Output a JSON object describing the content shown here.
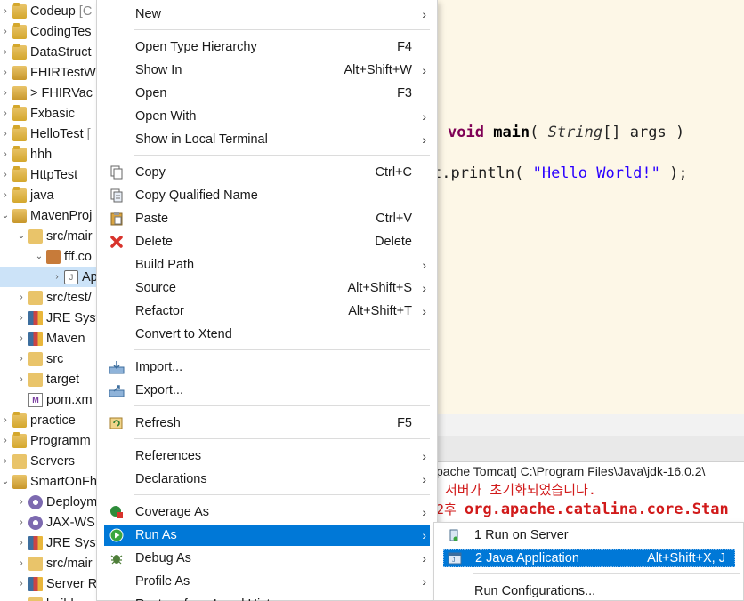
{
  "explorer": {
    "items": [
      {
        "label": "Codeup",
        "suffix": "[C",
        "icon": "project-icon",
        "chev": "›",
        "indent": 0
      },
      {
        "label": "CodingTes",
        "suffix": "",
        "icon": "project-icon",
        "chev": "›",
        "indent": 0
      },
      {
        "label": "DataStruct",
        "suffix": "",
        "icon": "project-icon",
        "chev": "›",
        "indent": 0
      },
      {
        "label": "FHIRTestW",
        "suffix": "",
        "icon": "maven-project-icon",
        "chev": "›",
        "indent": 0
      },
      {
        "label": "> FHIRVac",
        "suffix": "",
        "icon": "maven-project-icon",
        "chev": "›",
        "indent": 0
      },
      {
        "label": "Fxbasic",
        "suffix": "",
        "icon": "project-icon",
        "chev": "›",
        "indent": 0
      },
      {
        "label": "HelloTest",
        "suffix": "[",
        "icon": "project-icon",
        "chev": "›",
        "indent": 0
      },
      {
        "label": "hhh",
        "suffix": "",
        "icon": "project-icon",
        "chev": "›",
        "indent": 0
      },
      {
        "label": "HttpTest",
        "suffix": "",
        "icon": "project-icon",
        "chev": "›",
        "indent": 0
      },
      {
        "label": "java",
        "suffix": "",
        "icon": "project-icon",
        "chev": "›",
        "indent": 0
      },
      {
        "label": "MavenProj",
        "suffix": "",
        "icon": "maven-project-icon",
        "chev": "⌄",
        "indent": 0
      },
      {
        "label": "src/mair",
        "suffix": "",
        "icon": "source-folder-icon",
        "chev": "⌄",
        "indent": 1
      },
      {
        "label": "fff.co",
        "suffix": "",
        "icon": "package-icon",
        "chev": "⌄",
        "indent": 2
      },
      {
        "label": "Ap",
        "suffix": "",
        "icon": "java-file-icon",
        "chev": "›",
        "indent": 3
      },
      {
        "label": "src/test/",
        "suffix": "",
        "icon": "source-folder-icon",
        "chev": "›",
        "indent": 1
      },
      {
        "label": "JRE Syst",
        "suffix": "",
        "icon": "library-icon",
        "chev": "›",
        "indent": 1
      },
      {
        "label": "Maven",
        "suffix": "",
        "icon": "library-icon",
        "chev": "›",
        "indent": 1
      },
      {
        "label": "src",
        "suffix": "",
        "icon": "folder-icon",
        "chev": "›",
        "indent": 1
      },
      {
        "label": "target",
        "suffix": "",
        "icon": "folder-icon",
        "chev": "›",
        "indent": 1
      },
      {
        "label": "pom.xm",
        "suffix": "",
        "icon": "pom-file-icon",
        "chev": "",
        "indent": 1
      },
      {
        "label": "practice",
        "suffix": "",
        "icon": "project-icon",
        "chev": "›",
        "indent": 0
      },
      {
        "label": "Programm",
        "suffix": "",
        "icon": "project-icon",
        "chev": "›",
        "indent": 0
      },
      {
        "label": "Servers",
        "suffix": "",
        "icon": "folder-icon",
        "chev": "›",
        "indent": 0
      },
      {
        "label": "SmartOnFh",
        "suffix": "",
        "icon": "maven-project-icon",
        "chev": "⌄",
        "indent": 0
      },
      {
        "label": "Deploym",
        "suffix": "",
        "icon": "deployment-icon",
        "chev": "›",
        "indent": 1
      },
      {
        "label": "JAX-WS",
        "suffix": "",
        "icon": "webservice-icon",
        "chev": "›",
        "indent": 1
      },
      {
        "label": "JRE Syst",
        "suffix": "",
        "icon": "library-icon",
        "chev": "›",
        "indent": 1
      },
      {
        "label": "src/mair",
        "suffix": "",
        "icon": "source-folder-icon",
        "chev": "›",
        "indent": 1
      },
      {
        "label": "Server R",
        "suffix": "",
        "icon": "library-icon",
        "chev": "›",
        "indent": 1
      },
      {
        "label": "build",
        "suffix": "",
        "icon": "folder-icon",
        "chev": "›",
        "indent": 1
      }
    ]
  },
  "editor": {
    "line1": {
      "kw": "void",
      "method": "main",
      "open": "( ",
      "type": "String",
      "rest": "[] args )"
    },
    "line2": {
      "prefix": "t.println( ",
      "str": "\"Hello World!\"",
      "suffix": " );"
    }
  },
  "console": {
    "path": "pache Tomcat] C:\\Program Files\\Java\\jdk-16.0.2\\",
    "line1": "서버가 초기화되었습니다.",
    "line2_prefix": "2후 ",
    "line2_bold": "org.apache.catalina.core.Stan"
  },
  "context_menu": {
    "items": [
      {
        "label": "New",
        "shortcut": "",
        "arrow": "›",
        "icon": ""
      },
      {
        "label": "Open Type Hierarchy",
        "shortcut": "F4",
        "arrow": "",
        "icon": ""
      },
      {
        "label": "Show In",
        "shortcut": "Alt+Shift+W",
        "arrow": "›",
        "icon": ""
      },
      {
        "label": "Open",
        "shortcut": "F3",
        "arrow": "",
        "icon": ""
      },
      {
        "label": "Open With",
        "shortcut": "",
        "arrow": "›",
        "icon": ""
      },
      {
        "label": "Show in Local Terminal",
        "shortcut": "",
        "arrow": "›",
        "icon": ""
      },
      {
        "label": "Copy",
        "shortcut": "Ctrl+C",
        "arrow": "",
        "icon": "copy-icon"
      },
      {
        "label": "Copy Qualified Name",
        "shortcut": "",
        "arrow": "",
        "icon": "copy-qualified-icon"
      },
      {
        "label": "Paste",
        "shortcut": "Ctrl+V",
        "arrow": "",
        "icon": "paste-icon"
      },
      {
        "label": "Delete",
        "shortcut": "Delete",
        "arrow": "",
        "icon": "delete-icon"
      },
      {
        "label": "Build Path",
        "shortcut": "",
        "arrow": "›",
        "icon": ""
      },
      {
        "label": "Source",
        "shortcut": "Alt+Shift+S",
        "arrow": "›",
        "icon": ""
      },
      {
        "label": "Refactor",
        "shortcut": "Alt+Shift+T",
        "arrow": "›",
        "icon": ""
      },
      {
        "label": "Convert to Xtend",
        "shortcut": "",
        "arrow": "",
        "icon": ""
      },
      {
        "label": "Import...",
        "shortcut": "",
        "arrow": "",
        "icon": "import-icon"
      },
      {
        "label": "Export...",
        "shortcut": "",
        "arrow": "",
        "icon": "export-icon"
      },
      {
        "label": "Refresh",
        "shortcut": "F5",
        "arrow": "",
        "icon": "refresh-icon"
      },
      {
        "label": "References",
        "shortcut": "",
        "arrow": "›",
        "icon": ""
      },
      {
        "label": "Declarations",
        "shortcut": "",
        "arrow": "›",
        "icon": ""
      },
      {
        "label": "Coverage As",
        "shortcut": "",
        "arrow": "›",
        "icon": "coverage-icon"
      },
      {
        "label": "Run As",
        "shortcut": "",
        "arrow": "›",
        "icon": "run-icon"
      },
      {
        "label": "Debug As",
        "shortcut": "",
        "arrow": "›",
        "icon": "debug-icon"
      },
      {
        "label": "Profile As",
        "shortcut": "",
        "arrow": "›",
        "icon": ""
      },
      {
        "label": "Restore from Local History...",
        "shortcut": "",
        "arrow": "",
        "icon": ""
      }
    ]
  },
  "submenu": {
    "items": [
      {
        "label": "1 Run on Server",
        "shortcut": "",
        "icon": "server-icon"
      },
      {
        "label": "2 Java Application",
        "shortcut": "Alt+Shift+X, J",
        "icon": "java-app-icon"
      },
      {
        "label": "Run Configurations...",
        "shortcut": "",
        "icon": ""
      }
    ]
  },
  "colors": {
    "highlight": "#0078d7",
    "editor_bg": "#fdf7e7",
    "console_error": "#d11a1a"
  }
}
